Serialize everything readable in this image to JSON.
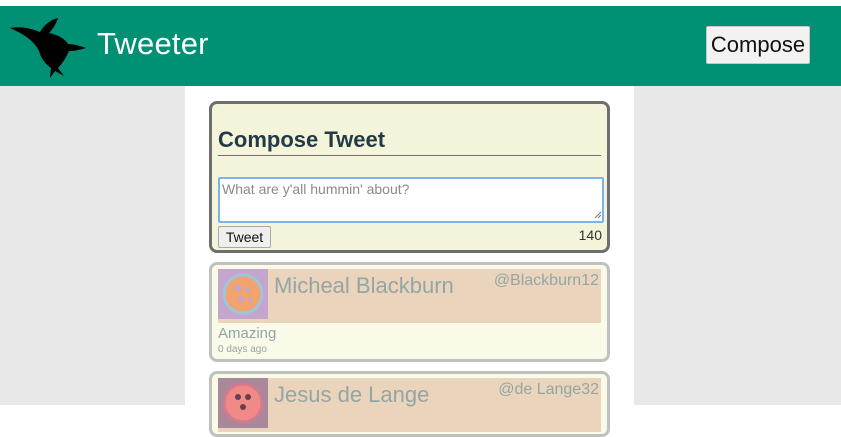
{
  "nav": {
    "brand": "Tweeter",
    "compose_label": "Compose",
    "logo_icon": "hummingbird-icon",
    "bg_color": "#009174"
  },
  "compose": {
    "title": "Compose Tweet",
    "placeholder": "What are y'all hummin' about?",
    "value": "",
    "tweet_button": "Tweet",
    "counter": "140"
  },
  "tweets": [
    {
      "name": "Micheal Blackburn",
      "handle": "@Blackburn12",
      "content": "Amazing",
      "time": "0 days ago",
      "avatar_icon": "avatar-icon"
    },
    {
      "name": "Jesus de Lange",
      "handle": "@de Lange32",
      "content": "",
      "time": "",
      "avatar_icon": "avatar-icon"
    }
  ],
  "colors": {
    "accent": "#009174",
    "compose_bg": "#f4f4db",
    "tweet_header_bg": "#ead5bc",
    "text_muted": "#94a5a6"
  }
}
